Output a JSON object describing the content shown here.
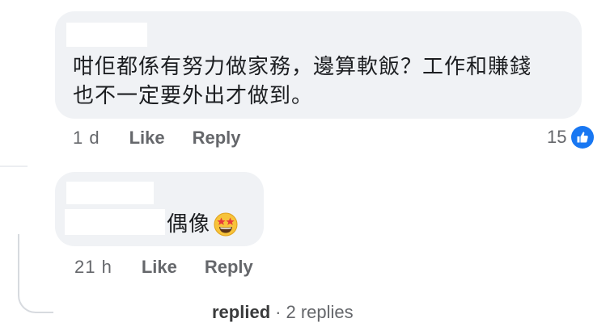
{
  "comments": [
    {
      "text_lines": [
        "咁佢都係有努力做家務，邊算軟飯？工作和賺錢",
        "也不一定要外出才做到。"
      ],
      "time": "1 d",
      "like_label": "Like",
      "reply_label": "Reply",
      "reaction_count": "15",
      "reaction_icon": "thumbs-up-icon",
      "reaction_color": "#1877f2"
    },
    {
      "text": "偶像",
      "emoji": "star-struck-emoji",
      "time": "21 h",
      "like_label": "Like",
      "reply_label": "Reply"
    }
  ],
  "thread": {
    "replied_label": "replied",
    "separator": "·",
    "replies_label": "2 replies"
  },
  "colors": {
    "bubble_background": "#f0f2f5",
    "meta_text": "#65676b",
    "body_text": "#1c1e21",
    "accent": "#1877f2"
  }
}
